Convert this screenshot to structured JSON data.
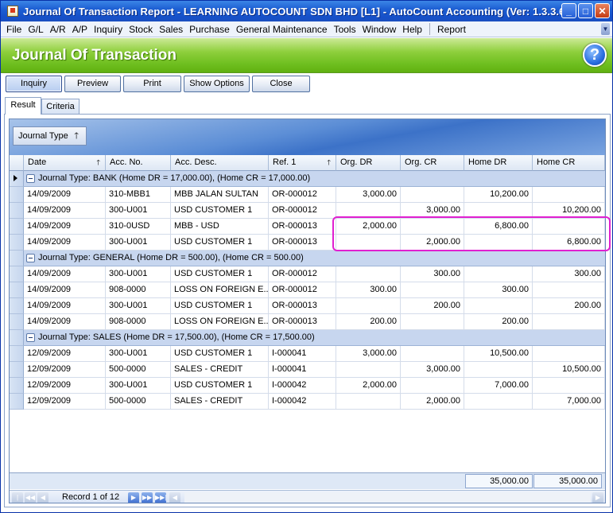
{
  "window": {
    "title": "Journal Of Transaction Report - LEARNING AUTOCOUNT SDN BHD [L1] - AutoCount Accounting (Ver: 1.3.3.6)",
    "minimize": "_",
    "maximize": "□",
    "close": "✕"
  },
  "menu": [
    "File",
    "G/L",
    "A/R",
    "A/P",
    "Inquiry",
    "Stock",
    "Sales",
    "Purchase",
    "General Maintenance",
    "Tools",
    "Window",
    "Help",
    "Report"
  ],
  "header": {
    "title": "Journal Of Transaction",
    "help": "?"
  },
  "toolbar": {
    "inquiry": "Inquiry",
    "preview": "Preview",
    "print": "Print",
    "show_options": "Show Options",
    "close": "Close"
  },
  "tabs": {
    "result": "Result",
    "criteria": "Criteria"
  },
  "groupby": {
    "label": "Journal Type",
    "arrow": "🡑"
  },
  "columns": {
    "date": "Date",
    "acc_no": "Acc. No.",
    "acc_desc": "Acc. Desc.",
    "ref1": "Ref. 1",
    "org_dr": "Org. DR",
    "org_cr": "Org. CR",
    "home_dr": "Home DR",
    "home_cr": "Home CR",
    "sort_up": "🡑"
  },
  "groups": [
    {
      "label": "Journal Type: BANK (Home DR = 17,000.00), (Home CR = 17,000.00)",
      "rows": [
        {
          "date": "14/09/2009",
          "acc_no": "310-MBB1",
          "acc_desc": "MBB JALAN SULTAN",
          "ref1": "OR-000012",
          "org_dr": "3,000.00",
          "org_cr": "",
          "home_dr": "10,200.00",
          "home_cr": ""
        },
        {
          "date": "14/09/2009",
          "acc_no": "300-U001",
          "acc_desc": "USD CUSTOMER 1",
          "ref1": "OR-000012",
          "org_dr": "",
          "org_cr": "3,000.00",
          "home_dr": "",
          "home_cr": "10,200.00"
        },
        {
          "date": "14/09/2009",
          "acc_no": "310-0USD",
          "acc_desc": "MBB - USD",
          "ref1": "OR-000013",
          "org_dr": "2,000.00",
          "org_cr": "",
          "home_dr": "6,800.00",
          "home_cr": ""
        },
        {
          "date": "14/09/2009",
          "acc_no": "300-U001",
          "acc_desc": "USD CUSTOMER 1",
          "ref1": "OR-000013",
          "org_dr": "",
          "org_cr": "2,000.00",
          "home_dr": "",
          "home_cr": "6,800.00"
        }
      ]
    },
    {
      "label": "Journal Type: GENERAL (Home DR = 500.00), (Home CR = 500.00)",
      "rows": [
        {
          "date": "14/09/2009",
          "acc_no": "300-U001",
          "acc_desc": "USD CUSTOMER 1",
          "ref1": "OR-000012",
          "org_dr": "",
          "org_cr": "300.00",
          "home_dr": "",
          "home_cr": "300.00"
        },
        {
          "date": "14/09/2009",
          "acc_no": "908-0000",
          "acc_desc": "LOSS ON FOREIGN E...",
          "ref1": "OR-000012",
          "org_dr": "300.00",
          "org_cr": "",
          "home_dr": "300.00",
          "home_cr": ""
        },
        {
          "date": "14/09/2009",
          "acc_no": "300-U001",
          "acc_desc": "USD CUSTOMER 1",
          "ref1": "OR-000013",
          "org_dr": "",
          "org_cr": "200.00",
          "home_dr": "",
          "home_cr": "200.00"
        },
        {
          "date": "14/09/2009",
          "acc_no": "908-0000",
          "acc_desc": "LOSS ON FOREIGN E...",
          "ref1": "OR-000013",
          "org_dr": "200.00",
          "org_cr": "",
          "home_dr": "200.00",
          "home_cr": ""
        }
      ]
    },
    {
      "label": "Journal Type: SALES (Home DR = 17,500.00), (Home CR = 17,500.00)",
      "rows": [
        {
          "date": "12/09/2009",
          "acc_no": "300-U001",
          "acc_desc": "USD CUSTOMER 1",
          "ref1": "I-000041",
          "org_dr": "3,000.00",
          "org_cr": "",
          "home_dr": "10,500.00",
          "home_cr": ""
        },
        {
          "date": "12/09/2009",
          "acc_no": "500-0000",
          "acc_desc": "SALES - CREDIT",
          "ref1": "I-000041",
          "org_dr": "",
          "org_cr": "3,000.00",
          "home_dr": "",
          "home_cr": "10,500.00"
        },
        {
          "date": "12/09/2009",
          "acc_no": "300-U001",
          "acc_desc": "USD CUSTOMER 1",
          "ref1": "I-000042",
          "org_dr": "2,000.00",
          "org_cr": "",
          "home_dr": "7,000.00",
          "home_cr": ""
        },
        {
          "date": "12/09/2009",
          "acc_no": "500-0000",
          "acc_desc": "SALES - CREDIT",
          "ref1": "I-000042",
          "org_dr": "",
          "org_cr": "2,000.00",
          "home_dr": "",
          "home_cr": "7,000.00"
        }
      ]
    }
  ],
  "totals": {
    "home_dr": "35,000.00",
    "home_cr": "35,000.00"
  },
  "navigator": {
    "record_text": "Record 1 of 12",
    "first": "|◀◀",
    "prev_page": "◀◀",
    "prev": "◀",
    "next": "▶",
    "next_page": "▶▶",
    "last": "▶▶|"
  },
  "colors": {
    "title_bar": "#1d5fd3",
    "header_green": "#8ecf3c",
    "group_row": "#c7d6ef",
    "highlight": "#e020d0"
  }
}
